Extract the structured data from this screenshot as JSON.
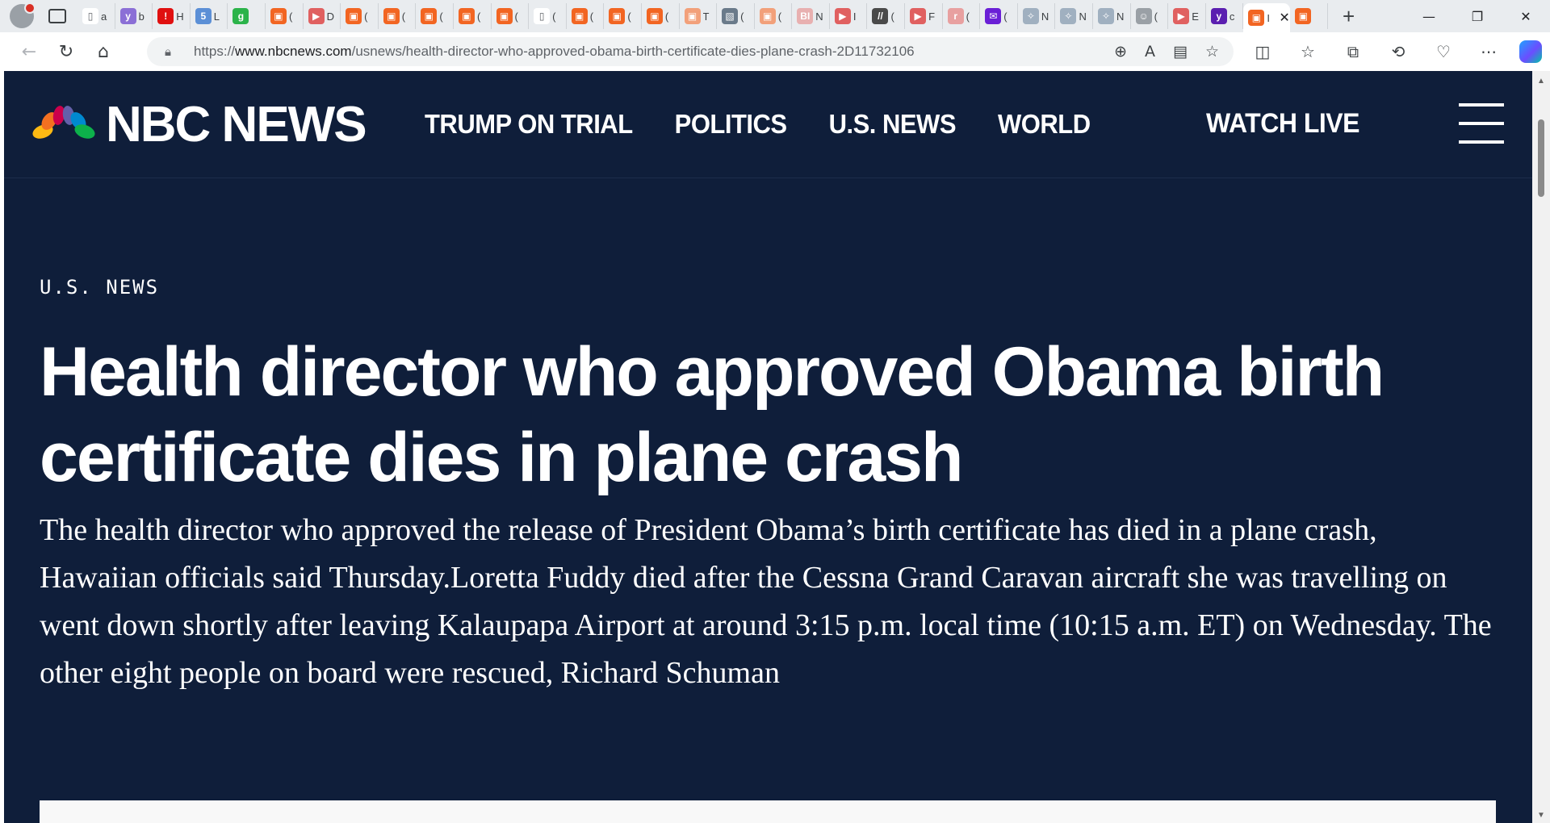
{
  "browser": {
    "tabs": [
      {
        "letter": "a",
        "color": "#ffffff",
        "glyph": "▯"
      },
      {
        "letter": "b",
        "color": "#8b6fd6",
        "glyph": "y"
      },
      {
        "letter": "H",
        "color": "#e01010",
        "glyph": "!"
      },
      {
        "letter": "L",
        "color": "#5b8fd6",
        "glyph": "5"
      },
      {
        "letter": "",
        "color": "#2bb34a",
        "glyph": "g"
      },
      {
        "letter": "(",
        "color": "#f26522",
        "glyph": "▣"
      },
      {
        "letter": "D",
        "color": "#e06060",
        "glyph": "▶"
      },
      {
        "letter": "(",
        "color": "#f26522",
        "glyph": "▣"
      },
      {
        "letter": "(",
        "color": "#f26522",
        "glyph": "▣"
      },
      {
        "letter": "(",
        "color": "#f26522",
        "glyph": "▣"
      },
      {
        "letter": "(",
        "color": "#f26522",
        "glyph": "▣"
      },
      {
        "letter": "(",
        "color": "#f26522",
        "glyph": "▣"
      },
      {
        "letter": "(",
        "color": "#ffffff",
        "glyph": "▯"
      },
      {
        "letter": "(",
        "color": "#f26522",
        "glyph": "▣"
      },
      {
        "letter": "(",
        "color": "#f26522",
        "glyph": "▣"
      },
      {
        "letter": "(",
        "color": "#f26522",
        "glyph": "▣"
      },
      {
        "letter": "T",
        "color": "#f2a07a",
        "glyph": "▣"
      },
      {
        "letter": "(",
        "color": "#6a7a8a",
        "glyph": "▧"
      },
      {
        "letter": "(",
        "color": "#f2a07a",
        "glyph": "▣"
      },
      {
        "letter": "N",
        "color": "#e8b0b0",
        "glyph": "BI"
      },
      {
        "letter": "I",
        "color": "#e06060",
        "glyph": "▶"
      },
      {
        "letter": "(",
        "color": "#4a4a4a",
        "glyph": "//"
      },
      {
        "letter": "F",
        "color": "#e06060",
        "glyph": "▶"
      },
      {
        "letter": "(",
        "color": "#e8a0a0",
        "glyph": "r"
      },
      {
        "letter": "(",
        "color": "#6a1fd6",
        "glyph": "✉"
      },
      {
        "letter": "N",
        "color": "#a0b0c0",
        "glyph": "✧"
      },
      {
        "letter": "N",
        "color": "#a0b0c0",
        "glyph": "✧"
      },
      {
        "letter": "N",
        "color": "#a0b0c0",
        "glyph": "✧"
      },
      {
        "letter": "(",
        "color": "#9aa0a6",
        "glyph": "☺"
      },
      {
        "letter": "E",
        "color": "#e06060",
        "glyph": "▶"
      },
      {
        "letter": "c",
        "color": "#5b1fb0",
        "glyph": "y"
      }
    ],
    "active_tab": {
      "letter": "I",
      "color": "#f26522",
      "glyph": "▣"
    },
    "url": {
      "scheme": "https://",
      "host": "www.nbcnews.com",
      "path": "/usnews/health-director-who-approved-obama-birth-certificate-dies-plane-crash-2D11732106"
    }
  },
  "site": {
    "logo_text": "NBC NEWS",
    "nav": [
      "TRUMP ON TRIAL",
      "POLITICS",
      "U.S. NEWS",
      "WORLD"
    ],
    "watch_live": "WATCH LIVE"
  },
  "article": {
    "section": "U.S. NEWS",
    "headline": "Health director who approved Obama birth certificate dies in plane crash",
    "dek": "The health director who approved the release of President Obama’s birth certificate has died in a plane crash, Hawaiian officials said Thursday.Loretta Fuddy died after the Cessna Grand Caravan aircraft she was travelling on went down shortly after leaving Kalaupapa Airport at around 3:15 p.m. local time (10:15 a.m. ET) on Wednesday. The other eight people on board were rescued, Richard Schuman"
  },
  "colors": {
    "page_bg": "#0f1e3a",
    "text": "#ffffff",
    "peacock": [
      "#fdb913",
      "#f37021",
      "#cc004c",
      "#6460aa",
      "#0089d0",
      "#0db14b"
    ]
  }
}
